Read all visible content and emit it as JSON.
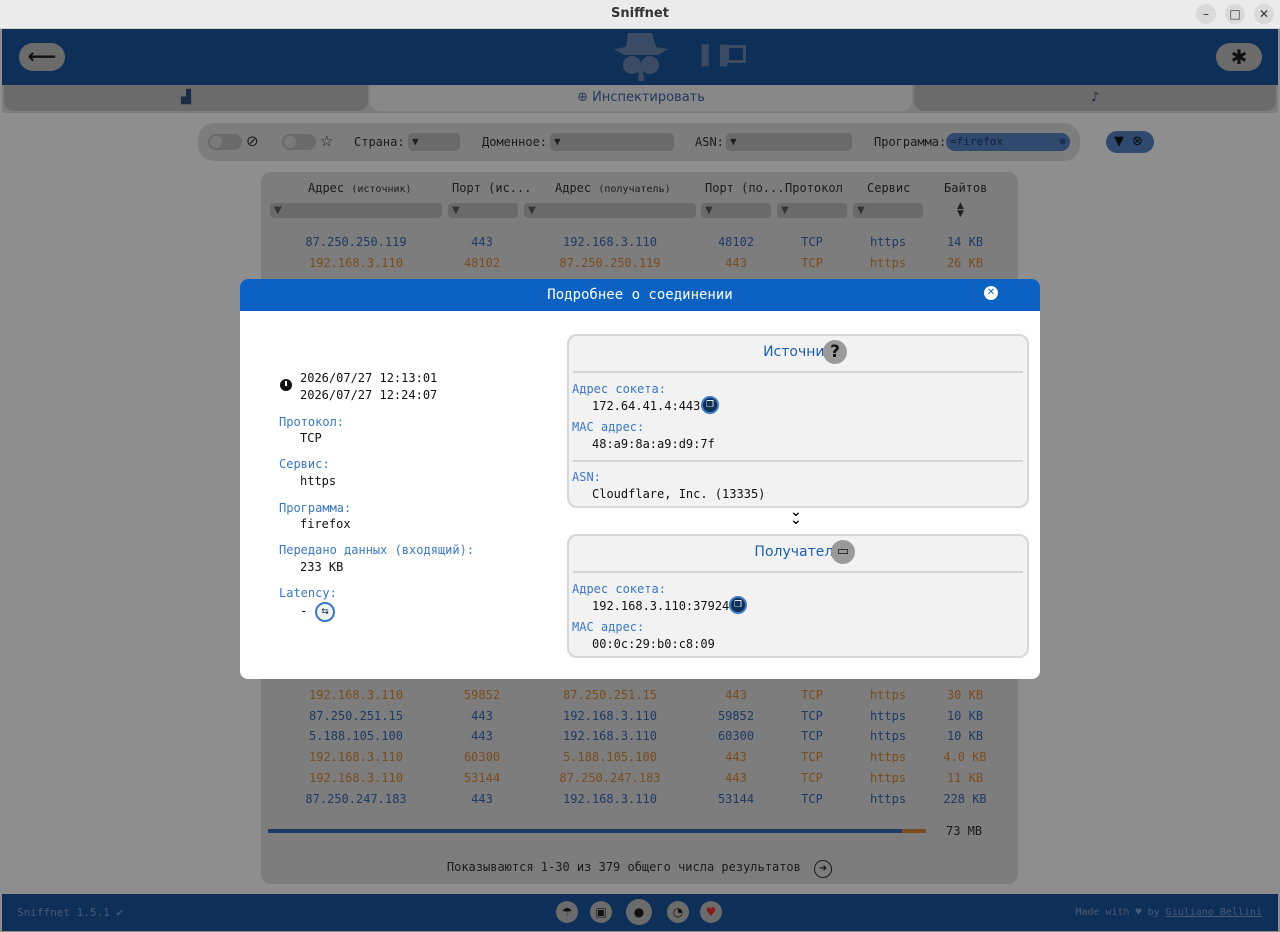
{
  "window": {
    "title": "Sniffnet"
  },
  "tabs": {
    "inspect": "Инспектировать"
  },
  "filters": {
    "country_label": "Страна:",
    "domain_label": "Доменное:",
    "asn_label": "ASN:",
    "program_label": "Программа:",
    "program_value": "=firefox"
  },
  "table": {
    "columns": [
      "Адрес",
      "(источник)",
      "Порт (ис...",
      "Адрес",
      "(получатель)",
      "Порт (по...",
      "Протокол",
      "Сервис",
      "Байтов"
    ],
    "rows_top": [
      [
        "87.250.250.119",
        "443",
        "192.168.3.110",
        "48102",
        "TCP",
        "https",
        "14 KB"
      ],
      [
        "192.168.3.110",
        "48102",
        "87.250.250.119",
        "443",
        "TCP",
        "https",
        "26 KB"
      ]
    ],
    "rows_bottom": [
      [
        "192.168.3.110",
        "59852",
        "87.250.251.15",
        "443",
        "TCP",
        "https",
        "30 KB"
      ],
      [
        "87.250.251.15",
        "443",
        "192.168.3.110",
        "59852",
        "TCP",
        "https",
        "10 KB"
      ],
      [
        "5.188.105.100",
        "443",
        "192.168.3.110",
        "60300",
        "TCP",
        "https",
        "10 KB"
      ],
      [
        "192.168.3.110",
        "60300",
        "5.188.105.100",
        "443",
        "TCP",
        "https",
        "4.0 KB"
      ],
      [
        "192.168.3.110",
        "53144",
        "87.250.247.183",
        "443",
        "TCP",
        "https",
        "11 KB"
      ],
      [
        "87.250.247.183",
        "443",
        "192.168.3.110",
        "53144",
        "TCP",
        "https",
        "228 KB"
      ]
    ],
    "total": "73 MB",
    "pagination": "Показываются 1-30 из 379 общего числа результатов"
  },
  "footer": {
    "version": "Sniffnet 1.5.1",
    "made_with": "Made with",
    "by": "by",
    "author": "Giuliano Bellini"
  },
  "modal": {
    "title": "Подробнее о соединении",
    "time_start": "2026/07/27 12:13:01",
    "time_end": "2026/07/27 12:24:07",
    "protocol_label": "Протокол:",
    "protocol": "TCP",
    "service_label": "Сервис:",
    "service": "https",
    "program_label": "Программа:",
    "program": "firefox",
    "data_label": "Передано данных (входящий):",
    "data": "233 KB",
    "latency_label": "Latency:",
    "latency": "-",
    "source": {
      "title": "Источник",
      "socket_label": "Адрес сокета:",
      "socket": "172.64.41.4:443",
      "mac_label": "MAC адрес:",
      "mac": "48:a9:8a:a9:d9:7f",
      "asn_label": "ASN:",
      "asn": "Cloudflare, Inc. (13335)"
    },
    "destination": {
      "title": "Получатель",
      "socket_label": "Адрес сокета:",
      "socket": "192.168.3.110:37924",
      "mac_label": "MAC адрес:",
      "mac": "00:0c:29:b0:c8:09"
    }
  },
  "colors": {
    "accent": "#0b62c3",
    "header_bg": "#0e2f58",
    "incoming": "#1e3a66",
    "outgoing": "#7a4c1e"
  },
  "icons": [
    "back-arrow-icon",
    "settings-icon",
    "pause-icon",
    "thumbnail-icon",
    "overview-icon",
    "inspect-icon",
    "bell-icon",
    "filter-icon",
    "clock-icon",
    "copy-icon",
    "question-icon",
    "computer-icon",
    "double-chevron-down-icon",
    "github-icon",
    "rss-icon",
    "heart-icon",
    "book-icon"
  ]
}
